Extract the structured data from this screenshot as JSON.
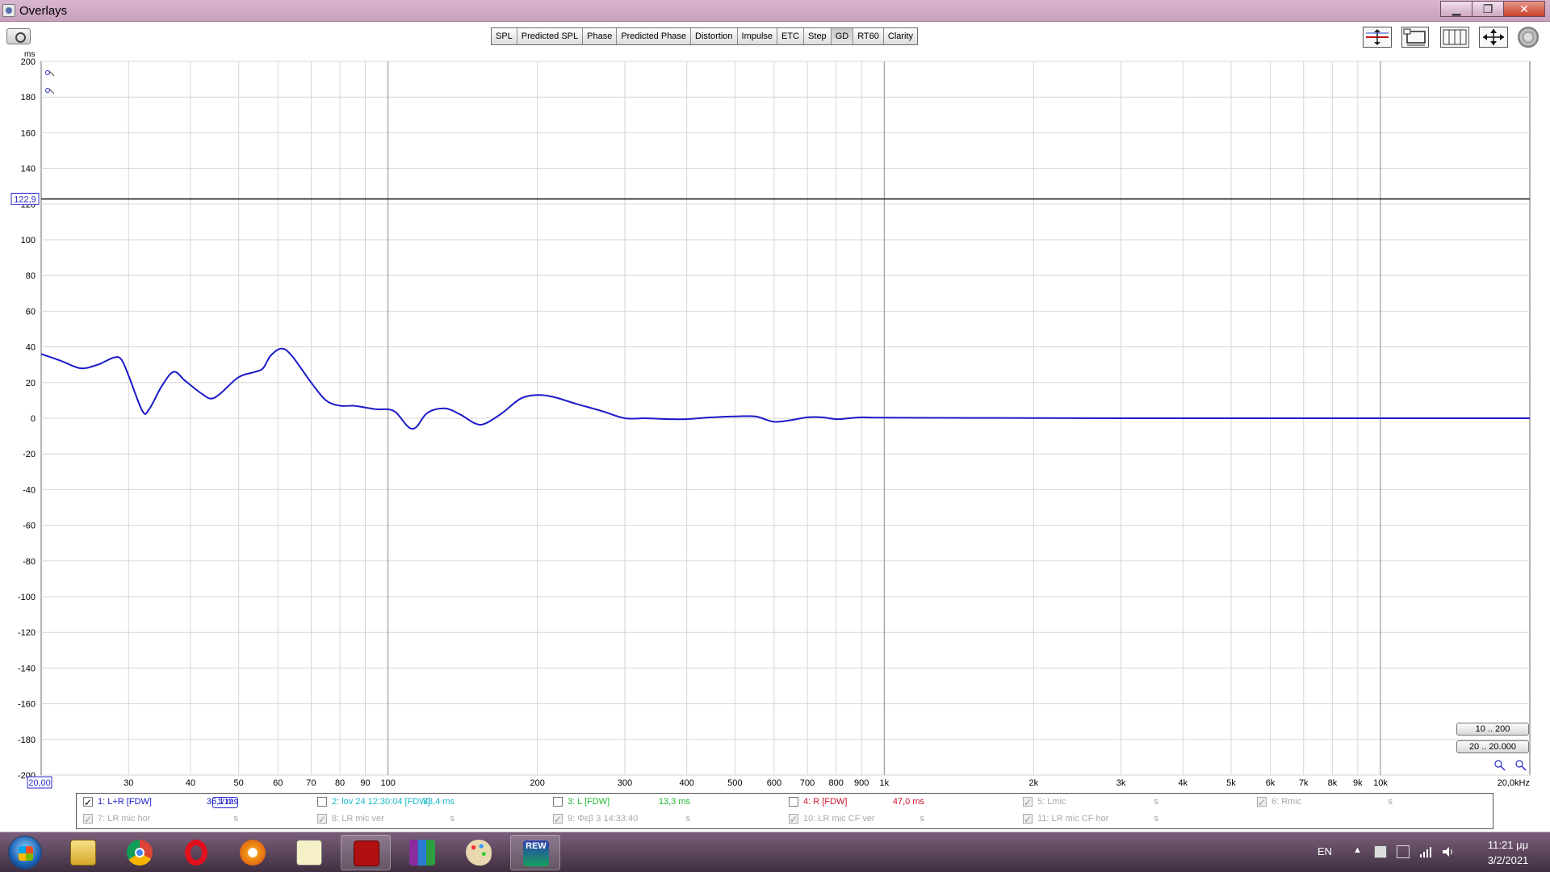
{
  "window": {
    "title": "Overlays"
  },
  "tabs": [
    "SPL",
    "Predicted SPL",
    "Phase",
    "Predicted Phase",
    "Distortion",
    "Impulse",
    "ETC",
    "Step",
    "GD",
    "RT60",
    "Clarity"
  ],
  "active_tab": "GD",
  "toolbar_icons": [
    "camera-icon",
    "align-vertical-icon",
    "window-fit-icon",
    "columns-icon",
    "move-arrows-icon",
    "gear-icon"
  ],
  "plot": {
    "y_unit": "ms",
    "cursor_value": "122,9",
    "cursor_x": "20,00",
    "range_buttons": [
      "10 .. 200",
      "20 .. 20.000"
    ],
    "zoom_icons": [
      "zoom-in-icon",
      "zoom-out-icon"
    ]
  },
  "chart_data": {
    "type": "line",
    "xlabel": "",
    "ylabel": "ms",
    "x_scale": "log",
    "xlim": [
      20,
      20000
    ],
    "ylim": [
      -200,
      200
    ],
    "grid": true,
    "y_ticks": [
      200,
      180,
      160,
      140,
      120,
      100,
      80,
      60,
      40,
      20,
      0,
      -20,
      -40,
      -60,
      -80,
      -100,
      -120,
      -140,
      -160,
      -180,
      -200
    ],
    "x_ticks": [
      {
        "v": 30,
        "t": "30"
      },
      {
        "v": 40,
        "t": "40"
      },
      {
        "v": 50,
        "t": "50"
      },
      {
        "v": 60,
        "t": "60"
      },
      {
        "v": 70,
        "t": "70"
      },
      {
        "v": 80,
        "t": "80"
      },
      {
        "v": 90,
        "t": "90"
      },
      {
        "v": 100,
        "t": "100"
      },
      {
        "v": 200,
        "t": "200"
      },
      {
        "v": 300,
        "t": "300"
      },
      {
        "v": 400,
        "t": "400"
      },
      {
        "v": 500,
        "t": "500"
      },
      {
        "v": 600,
        "t": "600"
      },
      {
        "v": 700,
        "t": "700"
      },
      {
        "v": 800,
        "t": "800"
      },
      {
        "v": 900,
        "t": "900"
      },
      {
        "v": 1000,
        "t": "1k"
      },
      {
        "v": 2000,
        "t": "2k"
      },
      {
        "v": 3000,
        "t": "3k"
      },
      {
        "v": 4000,
        "t": "4k"
      },
      {
        "v": 5000,
        "t": "5k"
      },
      {
        "v": 6000,
        "t": "6k"
      },
      {
        "v": 7000,
        "t": "7k"
      },
      {
        "v": 8000,
        "t": "8k"
      },
      {
        "v": 9000,
        "t": "9k"
      },
      {
        "v": 10000,
        "t": "10k"
      },
      {
        "v": 20000,
        "t": "20,0kHz"
      }
    ],
    "cursor_line_y": 122.9,
    "series": [
      {
        "name": "1: L+R [FDW]",
        "color": "#1a1ac8",
        "points": [
          [
            20,
            36
          ],
          [
            22,
            32
          ],
          [
            24,
            28
          ],
          [
            26,
            30
          ],
          [
            28,
            34
          ],
          [
            29,
            33
          ],
          [
            30,
            24
          ],
          [
            32,
            4
          ],
          [
            33,
            5
          ],
          [
            35,
            18
          ],
          [
            37,
            26
          ],
          [
            39,
            21
          ],
          [
            42,
            14
          ],
          [
            44,
            11
          ],
          [
            46,
            14
          ],
          [
            50,
            23
          ],
          [
            54,
            26
          ],
          [
            56,
            28
          ],
          [
            58,
            35
          ],
          [
            61,
            39
          ],
          [
            64,
            35
          ],
          [
            70,
            20
          ],
          [
            75,
            10
          ],
          [
            80,
            7
          ],
          [
            85,
            7
          ],
          [
            90,
            6
          ],
          [
            95,
            5
          ],
          [
            100,
            5
          ],
          [
            104,
            3
          ],
          [
            110,
            -5
          ],
          [
            114,
            -5
          ],
          [
            120,
            3
          ],
          [
            130,
            5.5
          ],
          [
            140,
            2
          ],
          [
            150,
            -3
          ],
          [
            157,
            -3
          ],
          [
            170,
            3
          ],
          [
            185,
            11
          ],
          [
            200,
            13
          ],
          [
            215,
            12
          ],
          [
            240,
            8
          ],
          [
            270,
            4
          ],
          [
            300,
            0
          ],
          [
            330,
            0
          ],
          [
            370,
            -0.5
          ],
          [
            400,
            -0.5
          ],
          [
            450,
            0.5
          ],
          [
            500,
            1
          ],
          [
            550,
            1
          ],
          [
            600,
            -2
          ],
          [
            650,
            -1
          ],
          [
            700,
            0.5
          ],
          [
            750,
            0.5
          ],
          [
            800,
            -0.5
          ],
          [
            850,
            0
          ],
          [
            900,
            0.5
          ],
          [
            1000,
            0.3
          ],
          [
            1500,
            0.2
          ],
          [
            2000,
            0.1
          ],
          [
            3000,
            0
          ],
          [
            5000,
            0
          ],
          [
            10000,
            0
          ],
          [
            20000,
            0
          ]
        ]
      }
    ]
  },
  "legend": [
    {
      "row": 0,
      "label": "1: L+R [FDW]",
      "value": "36,1 ms",
      "checked": true,
      "color": "#1a1ac8",
      "smoothing": "1/12"
    },
    {
      "row": 0,
      "label": "2: lov 24 12:30:04 [FDW]",
      "value": "33,4 ms",
      "checked": false,
      "color": "#18b6c8"
    },
    {
      "row": 0,
      "label": "3: L [FDW]",
      "value": "13,3 ms",
      "checked": false,
      "color": "#1fb830"
    },
    {
      "row": 0,
      "label": "4: R [FDW]",
      "value": "47,0 ms",
      "checked": false,
      "color": "#d0102b"
    },
    {
      "row": 0,
      "label": "5: Lmic",
      "value": "s",
      "checked": true,
      "color": "#a8a8a8",
      "grey": true
    },
    {
      "row": 0,
      "label": "6: Rmic",
      "value": "s",
      "checked": true,
      "color": "#a8a8a8",
      "grey": true
    },
    {
      "row": 1,
      "label": "7: LR mic hor",
      "value": "s",
      "checked": true,
      "color": "#a8a8a8",
      "grey": true
    },
    {
      "row": 1,
      "label": "8: LR mic ver",
      "value": "s",
      "checked": true,
      "color": "#a8a8a8",
      "grey": true
    },
    {
      "row": 1,
      "label": "9: Φεβ 3 14:33:40",
      "value": "s",
      "checked": true,
      "color": "#a8a8a8",
      "grey": true
    },
    {
      "row": 1,
      "label": "10: LR mic CF ver",
      "value": "s",
      "checked": true,
      "color": "#a8a8a8",
      "grey": true
    },
    {
      "row": 1,
      "label": "11: LR mic CF hor",
      "value": "s",
      "checked": true,
      "color": "#a8a8a8",
      "grey": true
    }
  ],
  "taskbar": {
    "apps": [
      "explorer-icon",
      "chrome-icon",
      "opera-icon",
      "browser-icon",
      "notepad-icon",
      "app-red-icon",
      "winrar-icon",
      "paint-icon",
      "rew-icon"
    ],
    "rew_label": "REW",
    "language": "EN",
    "time": "11:21 μμ",
    "date": "3/2/2021"
  }
}
